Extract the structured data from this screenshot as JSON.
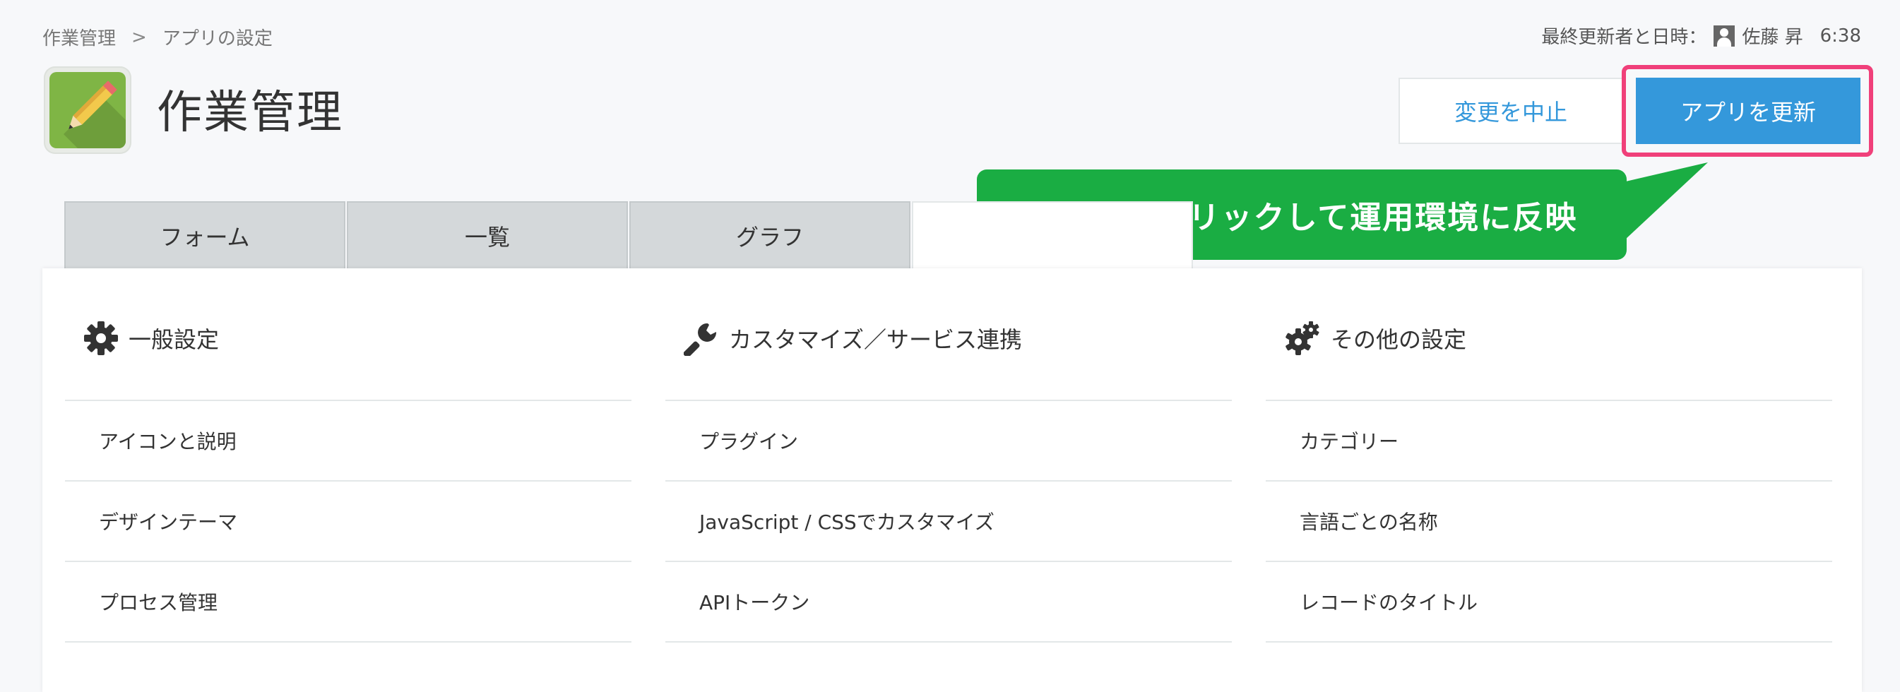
{
  "breadcrumb": {
    "app": "作業管理",
    "separator": ">",
    "current": "アプリの設定"
  },
  "last_updated": {
    "label": "最終更新者と日時：",
    "user": "佐藤 昇",
    "time": "6:38"
  },
  "app": {
    "title": "作業管理",
    "icon": "pencil-icon"
  },
  "actions": {
    "cancel_label": "変更を中止",
    "update_label": "アプリを更新"
  },
  "callout": {
    "text": "忘れずにクリックして運用環境に反映"
  },
  "tabs": [
    {
      "label": "フォーム"
    },
    {
      "label": "一覧"
    },
    {
      "label": "グラフ"
    },
    {
      "label": ""
    }
  ],
  "sections": [
    {
      "title": "一般設定",
      "icon": "gear-icon",
      "items": [
        "アイコンと説明",
        "デザインテーマ",
        "プロセス管理"
      ]
    },
    {
      "title": "カスタマイズ／サービス連携",
      "icon": "wrench-icon",
      "items": [
        "プラグイン",
        "JavaScript / CSSでカスタマイズ",
        "APIトークン"
      ]
    },
    {
      "title": "その他の設定",
      "icon": "gears-icon",
      "items": [
        "カテゴリー",
        "言語ごとの名称",
        "レコードのタイトル"
      ]
    }
  ],
  "colors": {
    "primary": "#3498db",
    "highlight": "#f0407a",
    "callout": "#1aad43",
    "app_icon": "#7fb545"
  }
}
